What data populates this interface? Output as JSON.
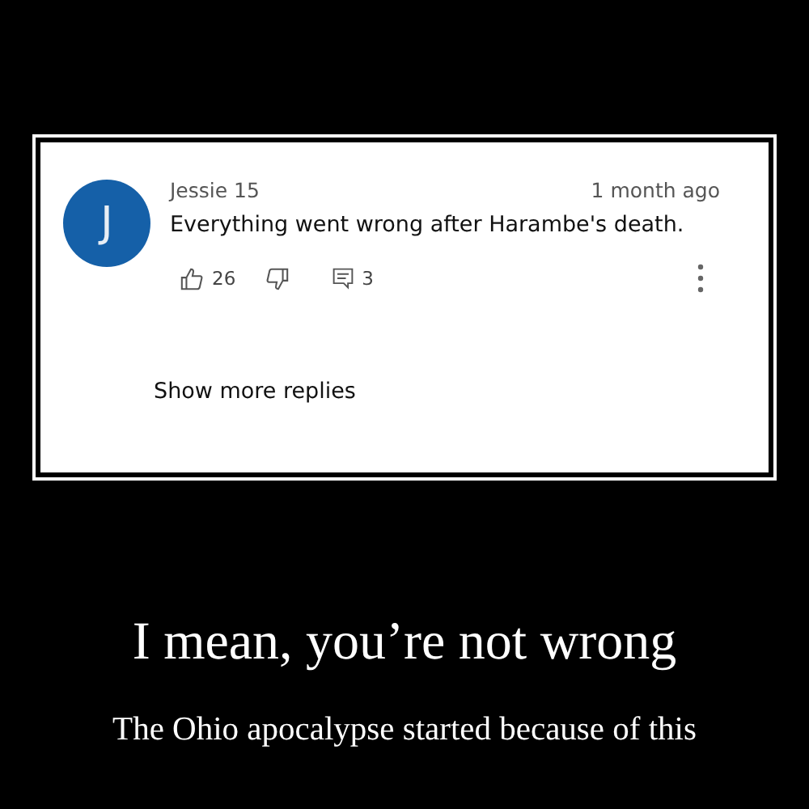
{
  "comment": {
    "avatar_letter": "J",
    "author": "Jessie 15",
    "time": "1 month ago",
    "text": "Everything went wrong after Harambe's death.",
    "likes": "26",
    "replies": "3"
  },
  "show_more": "Show more replies",
  "title": "I mean, you’re not wrong",
  "subtitle": "The Ohio apocalypse started because of this"
}
